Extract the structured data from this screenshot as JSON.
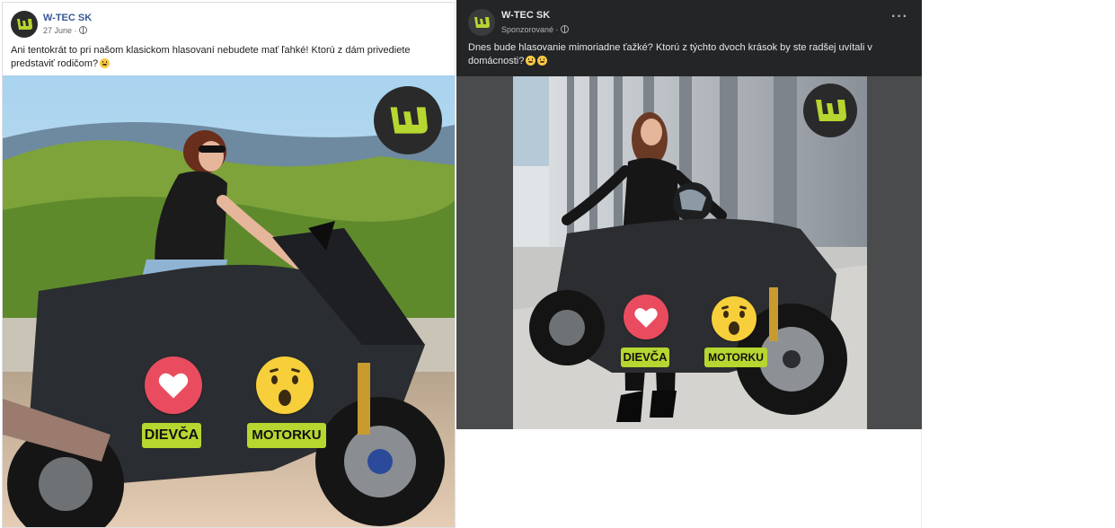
{
  "post1": {
    "page_name": "W-TEC SK",
    "date": "27 June",
    "text": "Ani tentokrát to pri našom klasickom hlasovaní nebudete mať ľahké! Ktorú z dám privediete predstaviť rodičom?",
    "vote_left": "DIEVČA",
    "vote_right": "MOTORKU"
  },
  "post2": {
    "page_name": "W-TEC SK",
    "meta": "Sponzorované",
    "text": "Dnes bude hlasovanie mimoriadne ťažké? Ktorú z týchto dvoch krások by ste radšej uvítali v domácnosti?",
    "vote_left": "DIEVČA",
    "vote_right": "MOTORKU"
  },
  "icons": {
    "logo": "w-tec-logo-icon",
    "heart": "heart-reaction-icon",
    "wow": "wow-reaction-icon",
    "globe": "globe-icon",
    "more": "more-options-icon"
  },
  "colors": {
    "brand_green": "#b6d630",
    "heart_red": "#ea4c5f",
    "wow_yellow": "#f6cf3b",
    "link_blue": "#385898",
    "dark_bg": "#242526"
  }
}
